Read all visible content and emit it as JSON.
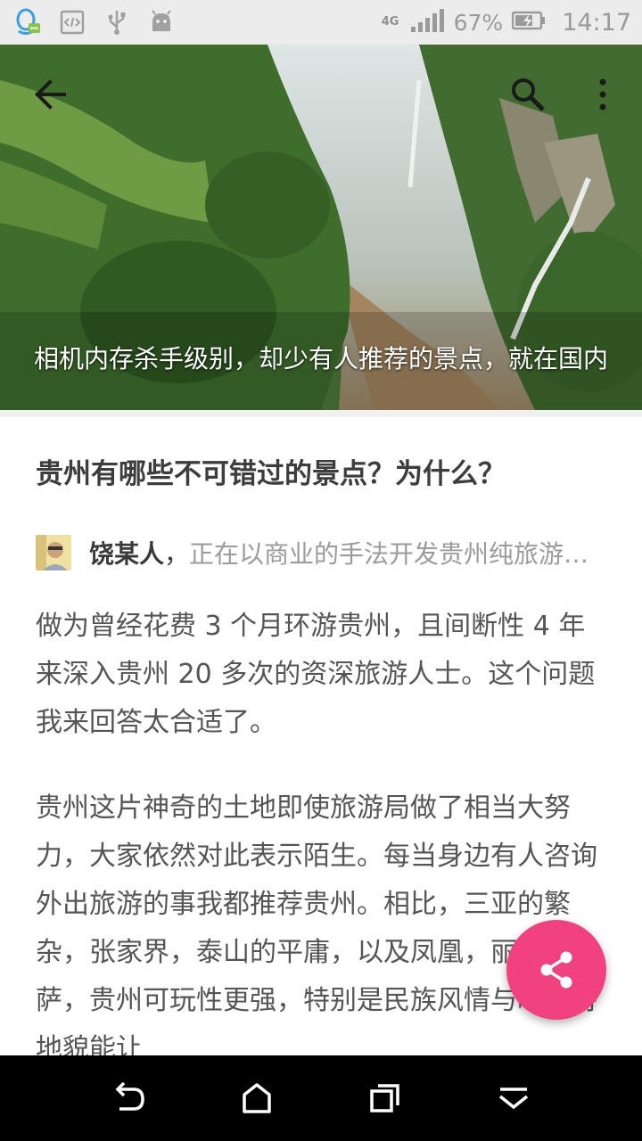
{
  "status_bar": {
    "icons": [
      "qq-icon",
      "code-icon",
      "usb-icon",
      "android-icon"
    ],
    "network": "4G",
    "battery_percent": "67%",
    "time": "14:17"
  },
  "hero": {
    "caption": "相机内存杀手级别，却少有人推荐的景点，就在国内",
    "icons": {
      "back": "back-arrow-icon",
      "search": "search-icon",
      "more": "more-vert-icon"
    }
  },
  "question": {
    "title": "贵州有哪些不可错过的景点？为什么？"
  },
  "author": {
    "name": "饶某人",
    "separator": "，",
    "bio": "正在以商业的手法开发贵州纯旅游资源"
  },
  "answer": {
    "paragraphs": [
      "做为曾经花费 3 个月环游贵州，且间断性 4 年来深入贵州 20 多次的资深旅游人士。这个问题我来回答太合适了。",
      "贵州这片神奇的土地即使旅游局做了相当大努力，大家依然对此表示陌生。每当身边有人咨询外出旅游的事我都推荐贵州。相比，三亚的繁杂，张家界，泰山的平庸，以及凤凰，丽江，拉萨，贵州可玩性更强，特别是民族风情与喀斯特地貌能让"
    ]
  },
  "fab": {
    "icon": "share-icon",
    "color": "#f2417f"
  },
  "nav_bar": {
    "icons": [
      "nav-back-icon",
      "nav-home-icon",
      "nav-recent-icon",
      "nav-down-icon"
    ]
  }
}
